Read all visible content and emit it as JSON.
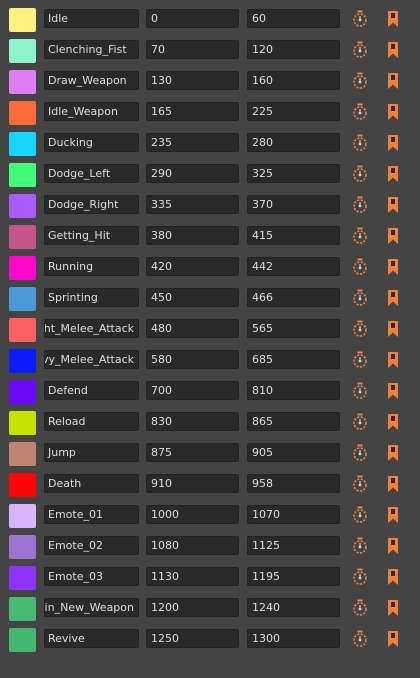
{
  "clips": [
    {
      "name": "Idle",
      "start": "0",
      "end": "60",
      "color": "#FFF27E"
    },
    {
      "name": "Clenching_Fist",
      "start": "70",
      "end": "120",
      "color": "#8CF4CA"
    },
    {
      "name": "Draw_Weapon",
      "start": "130",
      "end": "160",
      "color": "#DF7DF2"
    },
    {
      "name": "Idle_Weapon",
      "start": "165",
      "end": "225",
      "color": "#FC6C3A"
    },
    {
      "name": "Ducking",
      "start": "235",
      "end": "280",
      "color": "#18D6FB"
    },
    {
      "name": "Dodge_Left",
      "start": "290",
      "end": "325",
      "color": "#43FD79"
    },
    {
      "name": "Dodge_Right",
      "start": "335",
      "end": "370",
      "color": "#A95EFC"
    },
    {
      "name": "Getting_Hit",
      "start": "380",
      "end": "415",
      "color": "#C6558C"
    },
    {
      "name": "Running",
      "start": "420",
      "end": "442",
      "color": "#FB08CA"
    },
    {
      "name": "Sprinting",
      "start": "450",
      "end": "466",
      "color": "#4B98D7"
    },
    {
      "name": "Light_Melee_Attack",
      "start": "480",
      "end": "565",
      "color": "#FC6060"
    },
    {
      "name": "Heavy_Melee_Attack",
      "start": "580",
      "end": "685",
      "color": "#0C1CFD"
    },
    {
      "name": "Defend",
      "start": "700",
      "end": "810",
      "color": "#6A0AF9"
    },
    {
      "name": "Reload",
      "start": "830",
      "end": "865",
      "color": "#C4E101"
    },
    {
      "name": "Jump",
      "start": "875",
      "end": "905",
      "color": "#C08472"
    },
    {
      "name": "Death",
      "start": "910",
      "end": "958",
      "color": "#FC0508"
    },
    {
      "name": "Emote_01",
      "start": "1000",
      "end": "1070",
      "color": "#D9B4FA"
    },
    {
      "name": "Emote_02",
      "start": "1080",
      "end": "1125",
      "color": "#9C73D0"
    },
    {
      "name": "Emote_03",
      "start": "1130",
      "end": "1195",
      "color": "#8E34F7"
    },
    {
      "name": "Main_New_Weapon",
      "start": "1200",
      "end": "1240",
      "color": "#46B972"
    },
    {
      "name": "Revive",
      "start": "1250",
      "end": "1300",
      "color": "#43B66F"
    }
  ],
  "icons": {
    "preview": "timer-icon",
    "bookmark": "bookmark-icon"
  },
  "accent": {
    "icon_orange": "#F0803A",
    "icon_dark": "#2a2a2a"
  }
}
